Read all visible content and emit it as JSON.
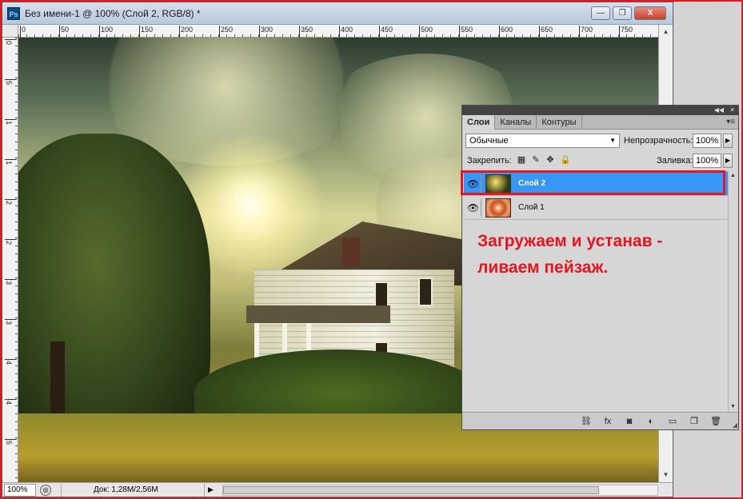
{
  "window": {
    "app_icon": "Ps",
    "title": "Без имени-1 @ 100% (Слой 2, RGB/8) *",
    "min_label": "—",
    "restore_label": "❐",
    "close_label": "X"
  },
  "rulers": {
    "top": [
      "0",
      "50",
      "100",
      "150",
      "200",
      "250",
      "300",
      "350",
      "400",
      "450",
      "500",
      "550",
      "600",
      "650",
      "700",
      "750"
    ],
    "left": [
      "0",
      "5",
      "1",
      "1",
      "2",
      "2",
      "3",
      "3",
      "4",
      "4",
      "5"
    ]
  },
  "status": {
    "zoom": "100%",
    "doc_info": "Док: 1,28M/2,56M",
    "arrow": "▶"
  },
  "layers_panel": {
    "tabs": [
      "Слои",
      "Каналы",
      "Контуры"
    ],
    "blend_mode": "Обычные",
    "opacity_label": "Непрозрачность:",
    "opacity_value": "100%",
    "lock_label": "Закрепить:",
    "fill_label": "Заливка:",
    "fill_value": "100%",
    "layers": [
      {
        "name": "Слой 2",
        "selected": true,
        "visible": true
      },
      {
        "name": "Слой 1",
        "selected": false,
        "visible": true
      }
    ]
  },
  "annotation": {
    "line1": "Загружаем и устанав -",
    "line2": "ливаем пейзаж."
  },
  "colors": {
    "highlight": "#e8141e",
    "selection": "#3796f6"
  }
}
